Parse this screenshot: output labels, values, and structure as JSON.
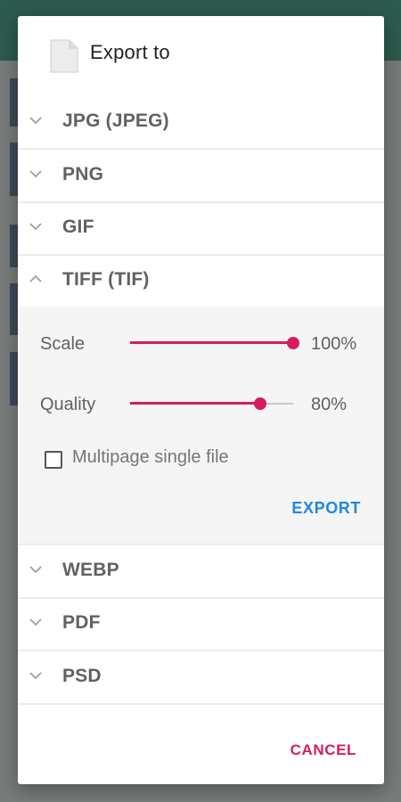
{
  "dialog": {
    "title": "Export to",
    "icon": "file-icon"
  },
  "formats": [
    {
      "label": "JPG (JPEG)",
      "expanded": false
    },
    {
      "label": "PNG",
      "expanded": false
    },
    {
      "label": "GIF",
      "expanded": false
    },
    {
      "label": "TIFF (TIF)",
      "expanded": true
    },
    {
      "label": "WEBP",
      "expanded": false
    },
    {
      "label": "PDF",
      "expanded": false
    },
    {
      "label": "PSD",
      "expanded": false
    }
  ],
  "options": {
    "scale": {
      "label": "Scale",
      "value_text": "100%",
      "level": 1.0
    },
    "quality": {
      "label": "Quality",
      "value_text": "80%",
      "level": 0.8
    },
    "multipage": {
      "label": "Multipage single file",
      "checked": false
    }
  },
  "actions": {
    "export_label": "EXPORT",
    "cancel_label": "CANCEL"
  },
  "colors": {
    "accent": "#d81b60",
    "export": "#1e88e5",
    "cancel": "#d81b60"
  }
}
